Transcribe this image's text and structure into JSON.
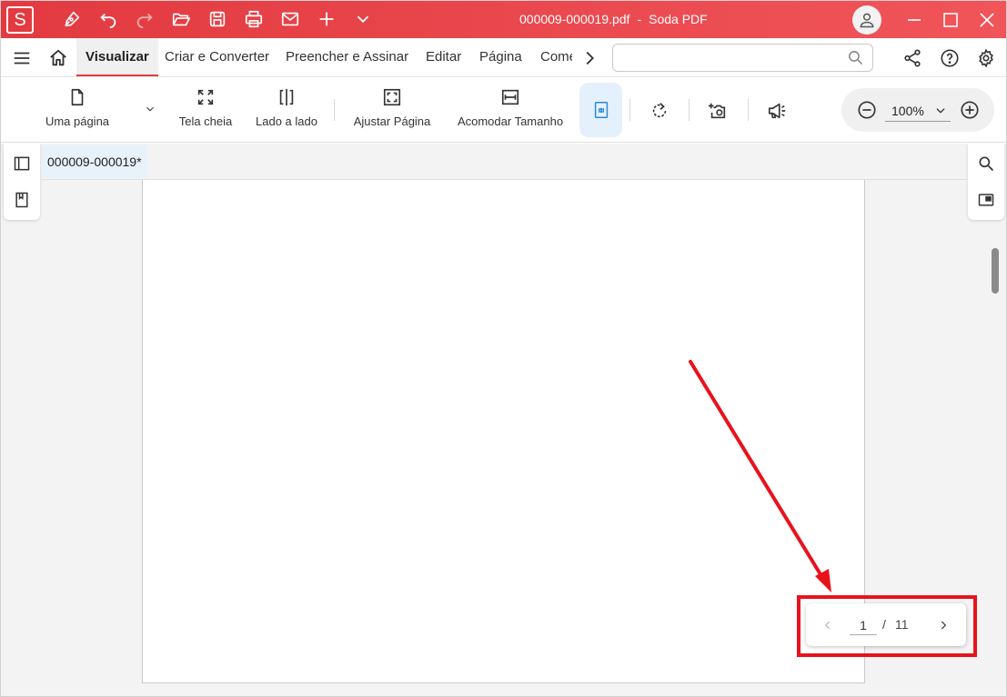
{
  "titlebar": {
    "logo_letter": "S",
    "file_name": "000009-000019.pdf",
    "separator": "-",
    "app_name": "Soda PDF"
  },
  "menu": {
    "tabs": [
      "Visualizar",
      "Criar e Converter",
      "Preencher e Assinar",
      "Editar",
      "Página",
      "Comentar"
    ],
    "active_tab": "Visualizar",
    "search_placeholder": ""
  },
  "ribbon": {
    "view_mode_label": "Uma página",
    "fullscreen_label": "Tela cheia",
    "side_by_side_label": "Lado a lado",
    "fit_page_label": "Ajustar Página",
    "fit_width_label": "Acomodar Tamanho",
    "zoom_value": "100%"
  },
  "document": {
    "tab_title": "000009-000019*",
    "current_page": "1",
    "page_separator": "/",
    "total_pages": "11"
  },
  "colors": {
    "brand_red": "#e23a40",
    "active_tool_bg": "#e4f0fb",
    "annotation_red": "#e8121d"
  },
  "icons": [
    "pen-icon",
    "undo-icon",
    "redo-icon",
    "open-folder-icon",
    "save-icon",
    "print-icon",
    "mail-icon",
    "add-icon",
    "more-chevron-icon",
    "user-icon",
    "minimize-icon",
    "maximize-icon",
    "close-icon",
    "hamburger-icon",
    "home-icon",
    "scroll-right-icon",
    "search-icon",
    "share-icon",
    "help-icon",
    "settings-icon",
    "single-page-icon",
    "fullscreen-icon",
    "side-by-side-icon",
    "fit-page-icon",
    "fit-width-icon",
    "actual-size-icon",
    "rotate-icon",
    "snapshot-icon",
    "read-aloud-icon",
    "zoom-out-icon",
    "zoom-in-icon",
    "panel-icon",
    "bookmark-icon",
    "find-icon",
    "split-view-icon",
    "prev-page-icon",
    "next-page-icon"
  ]
}
